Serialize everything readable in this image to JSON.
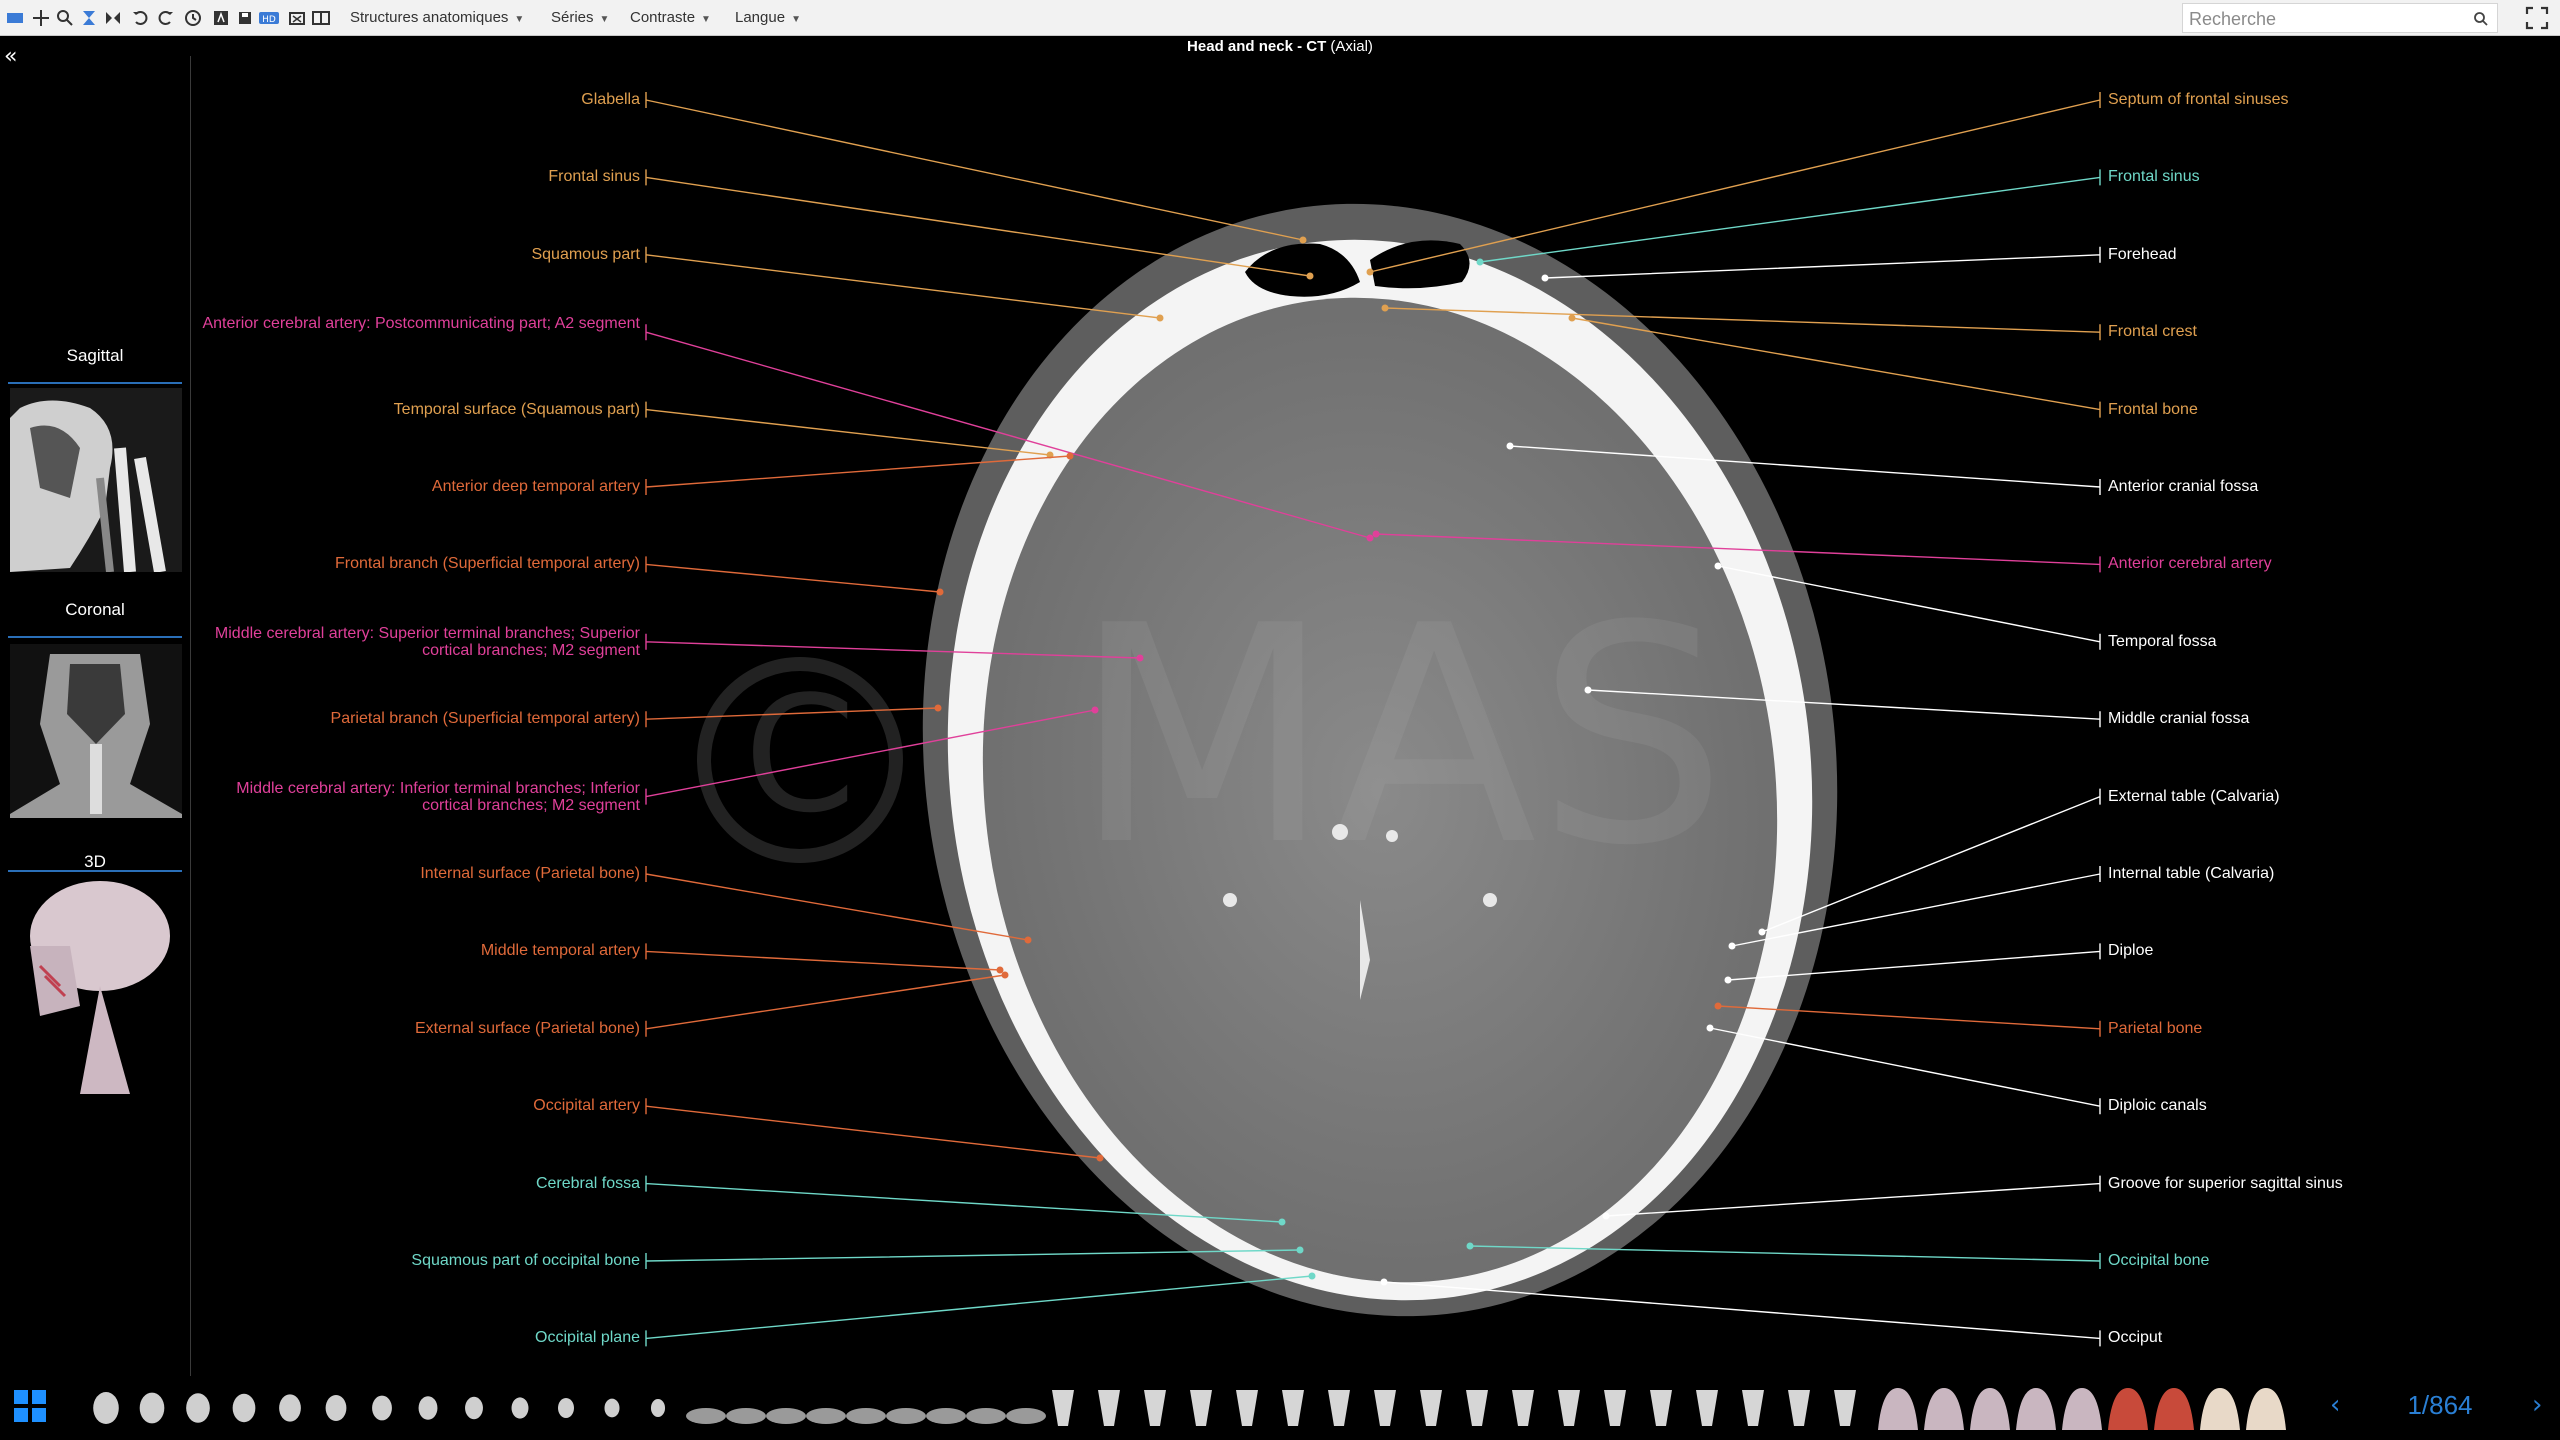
{
  "toolbar": {
    "menus": [
      {
        "label": "Structures anatomiques"
      },
      {
        "label": "Séries"
      },
      {
        "label": "Contraste"
      },
      {
        "label": "Langue"
      }
    ],
    "search_placeholder": "Recherche"
  },
  "viewer": {
    "title_bold": "Head and neck - CT",
    "title_rest": "(Axial)"
  },
  "sidebar": {
    "views": [
      {
        "label": "Sagittal"
      },
      {
        "label": "Coronal"
      },
      {
        "label": "3D"
      }
    ]
  },
  "colors": {
    "orange": "#e0a050",
    "red": "#e06a3a",
    "magenta": "#e0409a",
    "teal": "#6fd8c8",
    "white": "#ffffff",
    "accent_blue": "#2a7fd4"
  },
  "labels_left": [
    {
      "text": "Glabella",
      "color": "orange"
    },
    {
      "text": "Frontal sinus",
      "color": "orange"
    },
    {
      "text": "Squamous part",
      "color": "orange"
    },
    {
      "text": "Anterior cerebral artery: Postcommunicating part; A2 segment",
      "color": "magenta"
    },
    {
      "text": "Temporal surface (Squamous part)",
      "color": "orange"
    },
    {
      "text": "Anterior deep temporal artery",
      "color": "red"
    },
    {
      "text": "Frontal branch (Superficial temporal artery)",
      "color": "red"
    },
    {
      "text": "Middle cerebral artery: Superior terminal branches; Superior cortical branches; M2 segment",
      "color": "magenta"
    },
    {
      "text": "Parietal branch (Superficial temporal artery)",
      "color": "red"
    },
    {
      "text": "Middle cerebral artery: Inferior terminal branches; Inferior cortical branches; M2 segment",
      "color": "magenta"
    },
    {
      "text": "Internal surface (Parietal bone)",
      "color": "red"
    },
    {
      "text": "Middle temporal artery",
      "color": "red"
    },
    {
      "text": "External surface (Parietal bone)",
      "color": "red"
    },
    {
      "text": "Occipital artery",
      "color": "red"
    },
    {
      "text": "Cerebral fossa",
      "color": "teal"
    },
    {
      "text": "Squamous part of occipital bone",
      "color": "teal"
    },
    {
      "text": "Occipital plane",
      "color": "teal"
    }
  ],
  "labels_right": [
    {
      "text": "Septum of frontal sinuses",
      "color": "orange"
    },
    {
      "text": "Frontal sinus",
      "color": "teal"
    },
    {
      "text": "Forehead",
      "color": "white"
    },
    {
      "text": "Frontal crest",
      "color": "orange"
    },
    {
      "text": "Frontal bone",
      "color": "orange"
    },
    {
      "text": "Anterior cranial fossa",
      "color": "white"
    },
    {
      "text": "Anterior cerebral artery",
      "color": "magenta"
    },
    {
      "text": "Temporal fossa",
      "color": "white"
    },
    {
      "text": "Middle cranial fossa",
      "color": "white"
    },
    {
      "text": "External table (Calvaria)",
      "color": "white"
    },
    {
      "text": "Internal table (Calvaria)",
      "color": "white"
    },
    {
      "text": "Diploe",
      "color": "white"
    },
    {
      "text": "Parietal bone",
      "color": "red"
    },
    {
      "text": "Diploic canals",
      "color": "white"
    },
    {
      "text": "Groove for superior sagittal sinus",
      "color": "white"
    },
    {
      "text": "Occipital bone",
      "color": "teal"
    },
    {
      "text": "Occiput",
      "color": "white"
    }
  ],
  "pager": {
    "counter": "1/864"
  }
}
